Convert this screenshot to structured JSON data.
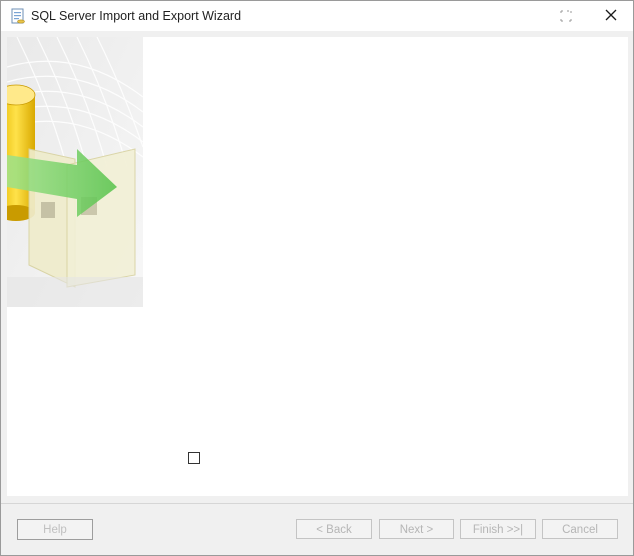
{
  "window": {
    "title": "SQL Server Import and Export Wizard",
    "app_icon": "wizard-app-icon"
  },
  "footer": {
    "help_label": "Help",
    "back_label": "< Back",
    "next_label": "Next >",
    "finish_label": "Finish >>|",
    "cancel_label": "Cancel"
  },
  "colors": {
    "window_background": "#f0f0f0",
    "content_background": "#ffffff",
    "disabled_text": "#b5b5b5"
  }
}
